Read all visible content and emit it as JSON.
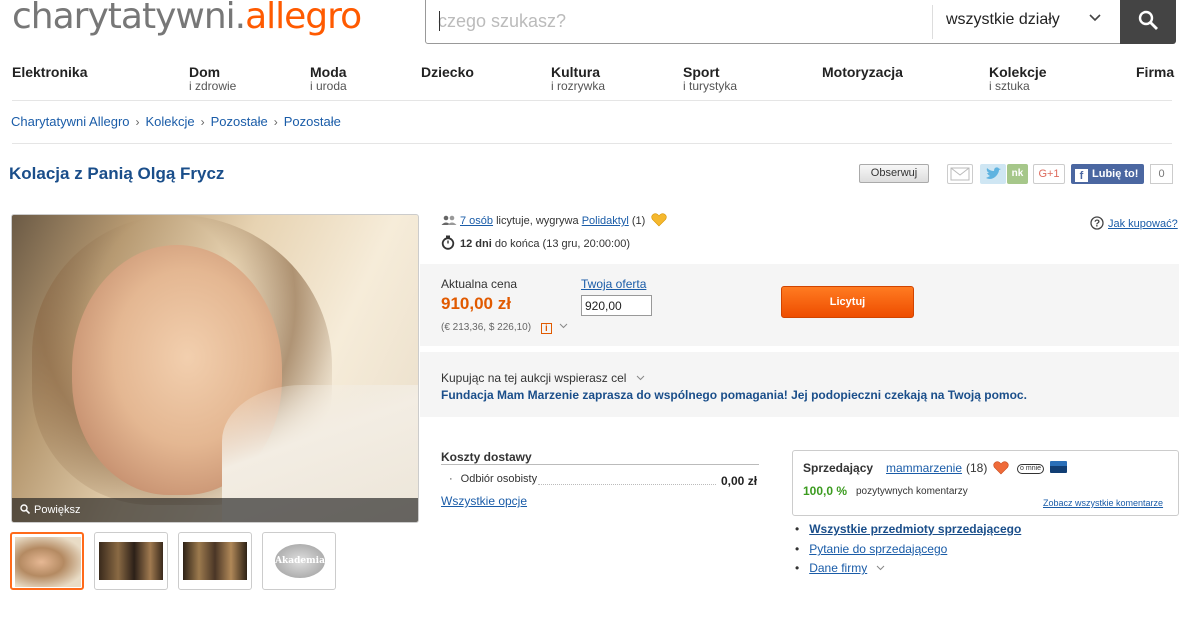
{
  "header": {
    "logo_part1": "charytatywni.",
    "logo_part2": "allegro",
    "search_placeholder": "czego szukasz?",
    "department": "wszystkie działy"
  },
  "categories": [
    {
      "main": "Elektronika",
      "sub": ""
    },
    {
      "main": "Dom",
      "sub": "i zdrowie"
    },
    {
      "main": "Moda",
      "sub": "i uroda"
    },
    {
      "main": "Dziecko",
      "sub": ""
    },
    {
      "main": "Kultura",
      "sub": "i rozrywka"
    },
    {
      "main": "Sport",
      "sub": "i turystyka"
    },
    {
      "main": "Motoryzacja",
      "sub": ""
    },
    {
      "main": "Kolekcje",
      "sub": "i sztuka"
    },
    {
      "main": "Firma",
      "sub": ""
    }
  ],
  "breadcrumbs": [
    "Charytatywni Allegro",
    "Kolekcje",
    "Pozostałe",
    "Pozostałe"
  ],
  "breadcrumb_sep": "›",
  "listing": {
    "title": "Kolacja z Panią Olgą Frycz",
    "watch_label": "Obserwuj",
    "like_label": "Lubię to!",
    "like_count": "0",
    "gplus": "G+1",
    "nk": "nk",
    "zoom_label": "Powiększ"
  },
  "auction": {
    "bidders_link": "7 osób",
    "bidders_text": "licytuje, wygrywa",
    "winner": "Polidaktyl",
    "winner_score": "(1)",
    "days_bold": "12 dni",
    "days_text": "do końca (13 gru, 20:00:00)",
    "howto": "Jak kupować?",
    "price_label": "Aktualna cena",
    "price": "910,00 zł",
    "conversion": "(€ 213,36, $ 226,10)",
    "offer_label": "Twoja oferta",
    "offer_value": "920,00",
    "bid_button": "Licytuj"
  },
  "charity": {
    "label": "Kupując na tej aukcji wspierasz cel",
    "text": "Fundacja Mam Marzenie zaprasza do wspólnego pomagania! Jej podopieczni czekają na Twoją pomoc."
  },
  "shipping": {
    "title": "Koszty dostawy",
    "item": "Odbiór osobisty",
    "price": "0,00 zł",
    "all_options": "Wszystkie opcje"
  },
  "seller": {
    "label": "Sprzedający",
    "name": "mammarzenie",
    "count": "(18)",
    "about_badge": "o mnie",
    "positive_pct": "100,0 %",
    "positive_text": "pozytywnych komentarzy",
    "all_comments": "Zobacz wszystkie komentarze",
    "links": [
      "Wszystkie przedmioty sprzedającego",
      "Pytanie do sprzedającego",
      "Dane firmy"
    ]
  },
  "thumbs": {
    "logo_text": "Akademia Smaku"
  },
  "colors": {
    "brand_orange": "#ff5a00",
    "link_blue": "#1a5ca8",
    "price_orange": "#e15a00",
    "positive_green": "#3b9b1f"
  }
}
